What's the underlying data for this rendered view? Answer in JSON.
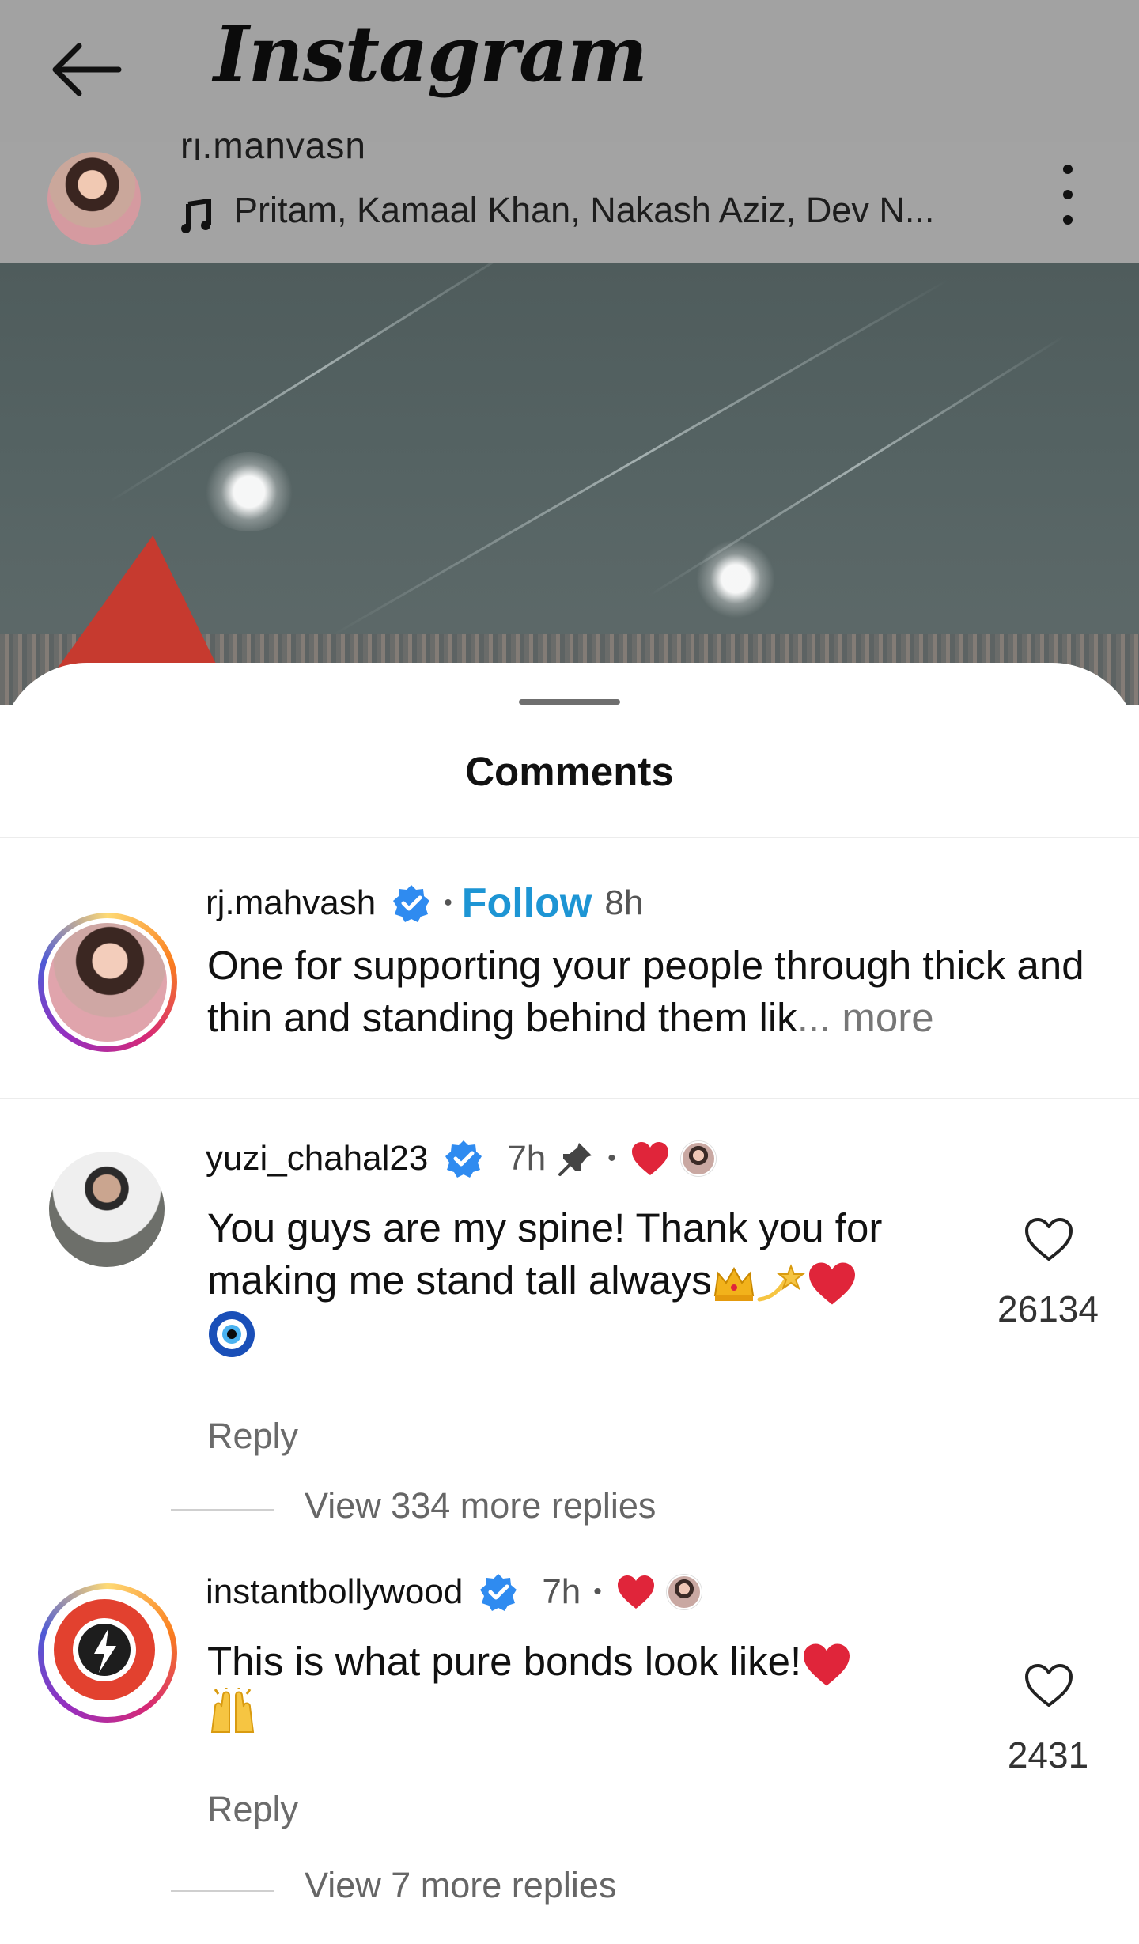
{
  "app": {
    "name": "Instagram"
  },
  "post": {
    "username": "rj.mahvash",
    "audio": "Pritam, Kamaal Khan, Nakash Aziz, Dev N..."
  },
  "sheet": {
    "title": "Comments"
  },
  "caption": {
    "username": "rj.mahvash",
    "follow_label": "Follow",
    "time": "8h",
    "text": "One for supporting your people through thick and thin and standing behind them lik",
    "more": "... more"
  },
  "comments": [
    {
      "username": "yuzi_chahal23",
      "time": "7h",
      "text_line1": "You guys are my spine! Thank you for",
      "text_line2": "making me stand tall always",
      "likes": "26134",
      "reply_label": "Reply",
      "view_replies": "View 334 more replies"
    },
    {
      "username": "instantbollywood",
      "time": "7h",
      "text_line1": "This is what pure bonds look like!",
      "likes": "2431",
      "reply_label": "Reply",
      "view_replies": "View 7 more replies"
    }
  ],
  "colors": {
    "follow": "#1d95d4",
    "verified": "#2f8bf0",
    "heart_red": "#e0253a"
  },
  "icons": [
    "back-arrow-icon",
    "music-note-icon",
    "more-options-icon",
    "verified-badge-icon",
    "pin-icon",
    "heart-outline-icon",
    "red-heart-icon"
  ]
}
